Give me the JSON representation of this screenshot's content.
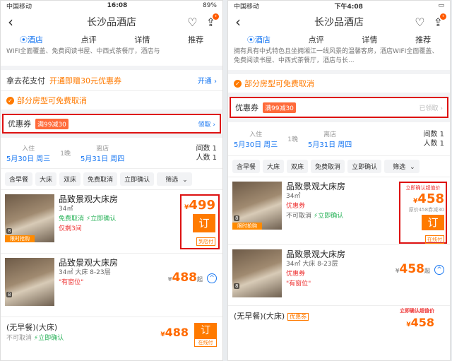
{
  "left": {
    "status": {
      "carrier": "中国移动",
      "time": "16:08",
      "battery": "89%"
    },
    "nav": {
      "title": "长沙品酒店"
    },
    "tabs": [
      "酒店",
      "点评",
      "详情",
      "推荐"
    ],
    "intro": "WIFI全面覆盖、免费阅读书屋、中西式茶餐厅，酒店与",
    "pay": {
      "label": "拿去花支付",
      "promo": "开通即赠30元优惠券",
      "link": "开通"
    },
    "cancel": "部分房型可免费取消",
    "coupon": {
      "label": "优惠券",
      "tag": "满99减30",
      "action": "领取"
    },
    "dates": {
      "in_label": "入住",
      "in": "5月30日 周三",
      "nights": "1晚",
      "out_label": "离店",
      "out": "5月31日 周四",
      "rooms": "间数 1",
      "people": "人数 1"
    },
    "filters": [
      "含早餐",
      "大床",
      "双床",
      "免费取消",
      "立即确认",
      "筛选"
    ],
    "rooms": [
      {
        "name": "品致景观大床房",
        "size": "34㎡",
        "free": "免费取消",
        "confirm": "立即确认",
        "left": "仅剩3间",
        "num": "8",
        "cap": "限时抢购",
        "price_sym": "¥",
        "price": "499",
        "book": "订",
        "pay": "到店付"
      },
      {
        "name": "品致景观大床房",
        "size": "34㎡ 大床 8-23层",
        "left": "\"有窗位\"",
        "num": "8",
        "price_sym": "¥",
        "price": "488",
        "suffix": "起",
        "expand": "^"
      }
    ],
    "bottom": {
      "name": "(无早餐)(大床)",
      "sub1": "不可取消",
      "sub2": "立即确认",
      "price_sym": "¥",
      "price": "488",
      "book": "订",
      "pay": "在线付"
    }
  },
  "right": {
    "status": {
      "carrier": "中国移动",
      "time": "下午4:08"
    },
    "nav": {
      "title": "长沙品酒店"
    },
    "tabs": [
      "酒店",
      "点评",
      "详情",
      "推荐"
    ],
    "intro": "拥有具有中式特色且坐拥湘江一线风景的温馨客房，酒店WIFI全面覆盖、免费阅读书屋、中西式茶餐厅，酒店与长...",
    "cancel": "部分房型可免费取消",
    "coupon": {
      "label": "优惠券",
      "tag": "满99减30",
      "action": "已领取"
    },
    "dates": {
      "in_label": "入住",
      "in": "5月30日 周三",
      "nights": "1晚",
      "out_label": "离店",
      "out": "5月31日 周四",
      "rooms": "间数 1",
      "people": "人数 1"
    },
    "filters": [
      "含早餐",
      "大床",
      "双床",
      "免费取消",
      "立即确认",
      "筛选"
    ],
    "rooms": [
      {
        "name": "品致景观大床房",
        "size": "34㎡",
        "badge": "优惠券",
        "free": "不可取消",
        "confirm": "立即确认",
        "num": "8",
        "cap": "限时抢购",
        "top": "立即确认超值价",
        "price_sym": "¥",
        "price": "458",
        "note": "原价458券减30",
        "book": "订",
        "pay": "在线付"
      },
      {
        "name": "品致景观大床房",
        "size": "34㎡ 大床 8-23层",
        "badge": "优惠券",
        "left": "\"有窗位\"",
        "num": "8",
        "price_sym": "¥",
        "price": "458",
        "suffix": "起",
        "expand": "^"
      }
    ],
    "bottom": {
      "name": "(无早餐)(大床)",
      "tag": "优惠券",
      "top": "立即确认超值价",
      "price_sym": "¥",
      "price": "458"
    }
  }
}
